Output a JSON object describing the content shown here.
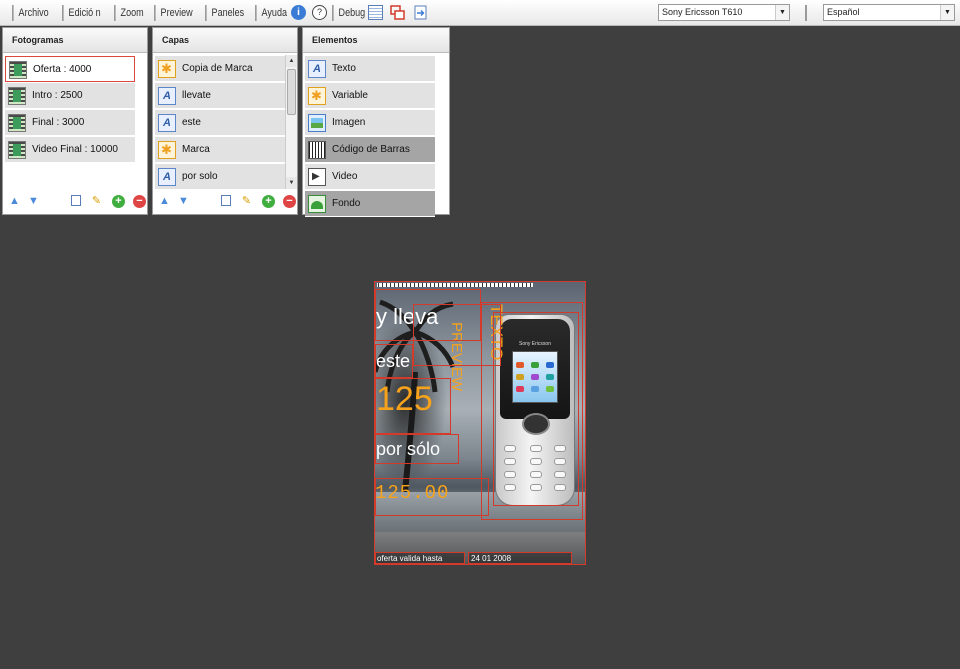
{
  "menu": {
    "archivo": "Archivo",
    "edicion": "Edició n",
    "zoom": "Zoom",
    "preview": "Preview",
    "paneles": "Paneles",
    "ayuda": "Ayuda",
    "debug": "Debug",
    "info_glyph": "i",
    "help_glyph": "?"
  },
  "device_select": {
    "value": "Sony Ericsson T610"
  },
  "language_select": {
    "value": "Español"
  },
  "panels": {
    "fotogramas": {
      "title": "Fotogramas",
      "items": [
        {
          "label": "Oferta : 4000"
        },
        {
          "label": "Intro : 2500"
        },
        {
          "label": "Final : 3000"
        },
        {
          "label": "Video Final : 10000"
        }
      ]
    },
    "capas": {
      "title": "Capas",
      "items": [
        {
          "label": "Copia de Marca"
        },
        {
          "label": "llevate"
        },
        {
          "label": "este"
        },
        {
          "label": "Marca"
        },
        {
          "label": "por solo"
        }
      ]
    },
    "elementos": {
      "title": "Elementos",
      "items": [
        {
          "label": "Texto"
        },
        {
          "label": "Variable"
        },
        {
          "label": "Imagen"
        },
        {
          "label": "Código de Barras"
        },
        {
          "label": "Video"
        },
        {
          "label": "Fondo"
        }
      ]
    }
  },
  "canvas": {
    "line1": "y lleva",
    "line2": "este",
    "price_big": "125",
    "line3": "por sólo",
    "price_small": "125.00",
    "vertical_1": "TEXTO",
    "vertical_2": "PREVIEW",
    "footer_left": "oferta valida hasta",
    "footer_right": "24 01 2008",
    "phone_brand": "Sony Ericsson"
  },
  "colors": {
    "accent_orange": "#f7a21b",
    "selection_red": "#d43a2a",
    "workspace_bg": "#3f3f3f"
  }
}
